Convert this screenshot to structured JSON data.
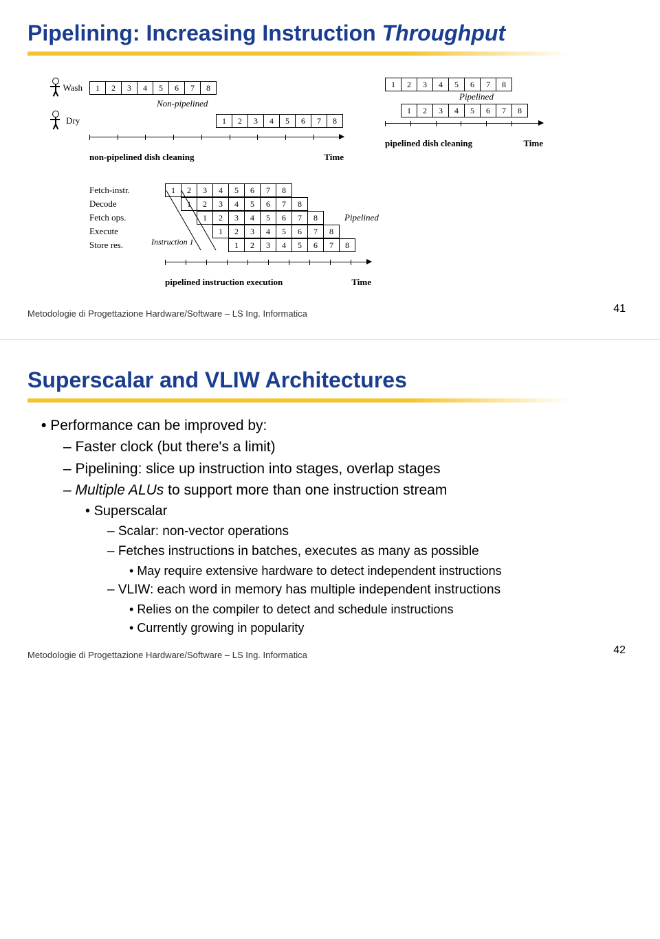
{
  "slide1": {
    "title_plain": "Pipelining: Increasing Instruction ",
    "title_italic": "Throughput",
    "wash": "Wash",
    "dry": "Dry",
    "nonpipe_label": "Non-pipelined",
    "pipe_label": "Pipelined",
    "axis_nonpipe": "non-pipelined dish cleaning",
    "axis_pipe": "pipelined dish cleaning",
    "time": "Time",
    "stage_labels": [
      "Fetch-instr.",
      "Decode",
      "Fetch ops.",
      "Execute",
      "Store res."
    ],
    "instr1": "Instruction 1",
    "axis_instr": "pipelined instruction execution",
    "cells": [
      "1",
      "2",
      "3",
      "4",
      "5",
      "6",
      "7",
      "8"
    ],
    "footer": "Metodologie di Progettazione Hardware/Software – LS Ing. Informatica",
    "page": "41",
    "pipe_label_right": "Pipelined"
  },
  "slide2": {
    "title": "Superscalar and VLIW Architectures",
    "b0": "Performance can be improved by:",
    "d1a": "Faster clock (but there's a limit)",
    "d1b": "Pipelining: slice up instruction into stages, overlap stages",
    "d1c_pre": "",
    "d1c_italic": "Multiple ALUs",
    "d1c_post": " to support more than one instruction stream",
    "b2a": "Superscalar",
    "d3a": "Scalar: non-vector operations",
    "d3b": "Fetches instructions in batches, executes as many as possible",
    "b4a": "May require extensive hardware to detect independent instructions",
    "d3c": "VLIW: each word in memory has multiple independent instructions",
    "b4b": "Relies on the compiler to detect and schedule instructions",
    "b4c": "Currently growing in popularity",
    "footer": "Metodologie di Progettazione Hardware/Software – LS Ing. Informatica",
    "page": "42"
  },
  "chart_data": [
    {
      "type": "table",
      "title": "Non-pipelined vs pipelined dish cleaning (two sequential 8-step tasks)",
      "nonpipelined": {
        "wash_start": 1,
        "wash_end": 8,
        "dry_start": 9,
        "dry_end": 16
      },
      "pipelined": {
        "wash_start": 1,
        "wash_end": 8,
        "dry_start": 2,
        "dry_end": 9
      },
      "steps_per_task": 8
    },
    {
      "type": "table",
      "title": "Pipelined instruction execution — 5-stage pipeline, 8 instructions",
      "stages": [
        "Fetch-instr.",
        "Decode",
        "Fetch ops.",
        "Execute",
        "Store res."
      ],
      "instructions": 8,
      "stage_offset_cycles": [
        0,
        1,
        2,
        3,
        4
      ],
      "total_cycles": 12
    }
  ]
}
